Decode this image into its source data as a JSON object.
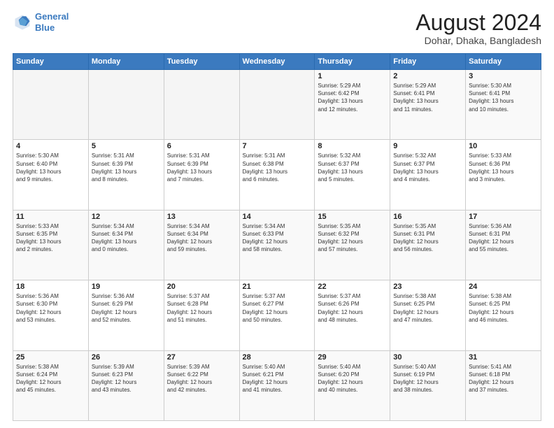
{
  "header": {
    "logo_line1": "General",
    "logo_line2": "Blue",
    "main_title": "August 2024",
    "subtitle": "Dohar, Dhaka, Bangladesh"
  },
  "days_of_week": [
    "Sunday",
    "Monday",
    "Tuesday",
    "Wednesday",
    "Thursday",
    "Friday",
    "Saturday"
  ],
  "weeks": [
    [
      {
        "day": "",
        "info": ""
      },
      {
        "day": "",
        "info": ""
      },
      {
        "day": "",
        "info": ""
      },
      {
        "day": "",
        "info": ""
      },
      {
        "day": "1",
        "info": "Sunrise: 5:29 AM\nSunset: 6:42 PM\nDaylight: 13 hours\nand 12 minutes."
      },
      {
        "day": "2",
        "info": "Sunrise: 5:29 AM\nSunset: 6:41 PM\nDaylight: 13 hours\nand 11 minutes."
      },
      {
        "day": "3",
        "info": "Sunrise: 5:30 AM\nSunset: 6:41 PM\nDaylight: 13 hours\nand 10 minutes."
      }
    ],
    [
      {
        "day": "4",
        "info": "Sunrise: 5:30 AM\nSunset: 6:40 PM\nDaylight: 13 hours\nand 9 minutes."
      },
      {
        "day": "5",
        "info": "Sunrise: 5:31 AM\nSunset: 6:39 PM\nDaylight: 13 hours\nand 8 minutes."
      },
      {
        "day": "6",
        "info": "Sunrise: 5:31 AM\nSunset: 6:39 PM\nDaylight: 13 hours\nand 7 minutes."
      },
      {
        "day": "7",
        "info": "Sunrise: 5:31 AM\nSunset: 6:38 PM\nDaylight: 13 hours\nand 6 minutes."
      },
      {
        "day": "8",
        "info": "Sunrise: 5:32 AM\nSunset: 6:37 PM\nDaylight: 13 hours\nand 5 minutes."
      },
      {
        "day": "9",
        "info": "Sunrise: 5:32 AM\nSunset: 6:37 PM\nDaylight: 13 hours\nand 4 minutes."
      },
      {
        "day": "10",
        "info": "Sunrise: 5:33 AM\nSunset: 6:36 PM\nDaylight: 13 hours\nand 3 minutes."
      }
    ],
    [
      {
        "day": "11",
        "info": "Sunrise: 5:33 AM\nSunset: 6:35 PM\nDaylight: 13 hours\nand 2 minutes."
      },
      {
        "day": "12",
        "info": "Sunrise: 5:34 AM\nSunset: 6:34 PM\nDaylight: 13 hours\nand 0 minutes."
      },
      {
        "day": "13",
        "info": "Sunrise: 5:34 AM\nSunset: 6:34 PM\nDaylight: 12 hours\nand 59 minutes."
      },
      {
        "day": "14",
        "info": "Sunrise: 5:34 AM\nSunset: 6:33 PM\nDaylight: 12 hours\nand 58 minutes."
      },
      {
        "day": "15",
        "info": "Sunrise: 5:35 AM\nSunset: 6:32 PM\nDaylight: 12 hours\nand 57 minutes."
      },
      {
        "day": "16",
        "info": "Sunrise: 5:35 AM\nSunset: 6:31 PM\nDaylight: 12 hours\nand 56 minutes."
      },
      {
        "day": "17",
        "info": "Sunrise: 5:36 AM\nSunset: 6:31 PM\nDaylight: 12 hours\nand 55 minutes."
      }
    ],
    [
      {
        "day": "18",
        "info": "Sunrise: 5:36 AM\nSunset: 6:30 PM\nDaylight: 12 hours\nand 53 minutes."
      },
      {
        "day": "19",
        "info": "Sunrise: 5:36 AM\nSunset: 6:29 PM\nDaylight: 12 hours\nand 52 minutes."
      },
      {
        "day": "20",
        "info": "Sunrise: 5:37 AM\nSunset: 6:28 PM\nDaylight: 12 hours\nand 51 minutes."
      },
      {
        "day": "21",
        "info": "Sunrise: 5:37 AM\nSunset: 6:27 PM\nDaylight: 12 hours\nand 50 minutes."
      },
      {
        "day": "22",
        "info": "Sunrise: 5:37 AM\nSunset: 6:26 PM\nDaylight: 12 hours\nand 48 minutes."
      },
      {
        "day": "23",
        "info": "Sunrise: 5:38 AM\nSunset: 6:25 PM\nDaylight: 12 hours\nand 47 minutes."
      },
      {
        "day": "24",
        "info": "Sunrise: 5:38 AM\nSunset: 6:25 PM\nDaylight: 12 hours\nand 46 minutes."
      }
    ],
    [
      {
        "day": "25",
        "info": "Sunrise: 5:38 AM\nSunset: 6:24 PM\nDaylight: 12 hours\nand 45 minutes."
      },
      {
        "day": "26",
        "info": "Sunrise: 5:39 AM\nSunset: 6:23 PM\nDaylight: 12 hours\nand 43 minutes."
      },
      {
        "day": "27",
        "info": "Sunrise: 5:39 AM\nSunset: 6:22 PM\nDaylight: 12 hours\nand 42 minutes."
      },
      {
        "day": "28",
        "info": "Sunrise: 5:40 AM\nSunset: 6:21 PM\nDaylight: 12 hours\nand 41 minutes."
      },
      {
        "day": "29",
        "info": "Sunrise: 5:40 AM\nSunset: 6:20 PM\nDaylight: 12 hours\nand 40 minutes."
      },
      {
        "day": "30",
        "info": "Sunrise: 5:40 AM\nSunset: 6:19 PM\nDaylight: 12 hours\nand 38 minutes."
      },
      {
        "day": "31",
        "info": "Sunrise: 5:41 AM\nSunset: 6:18 PM\nDaylight: 12 hours\nand 37 minutes."
      }
    ]
  ]
}
